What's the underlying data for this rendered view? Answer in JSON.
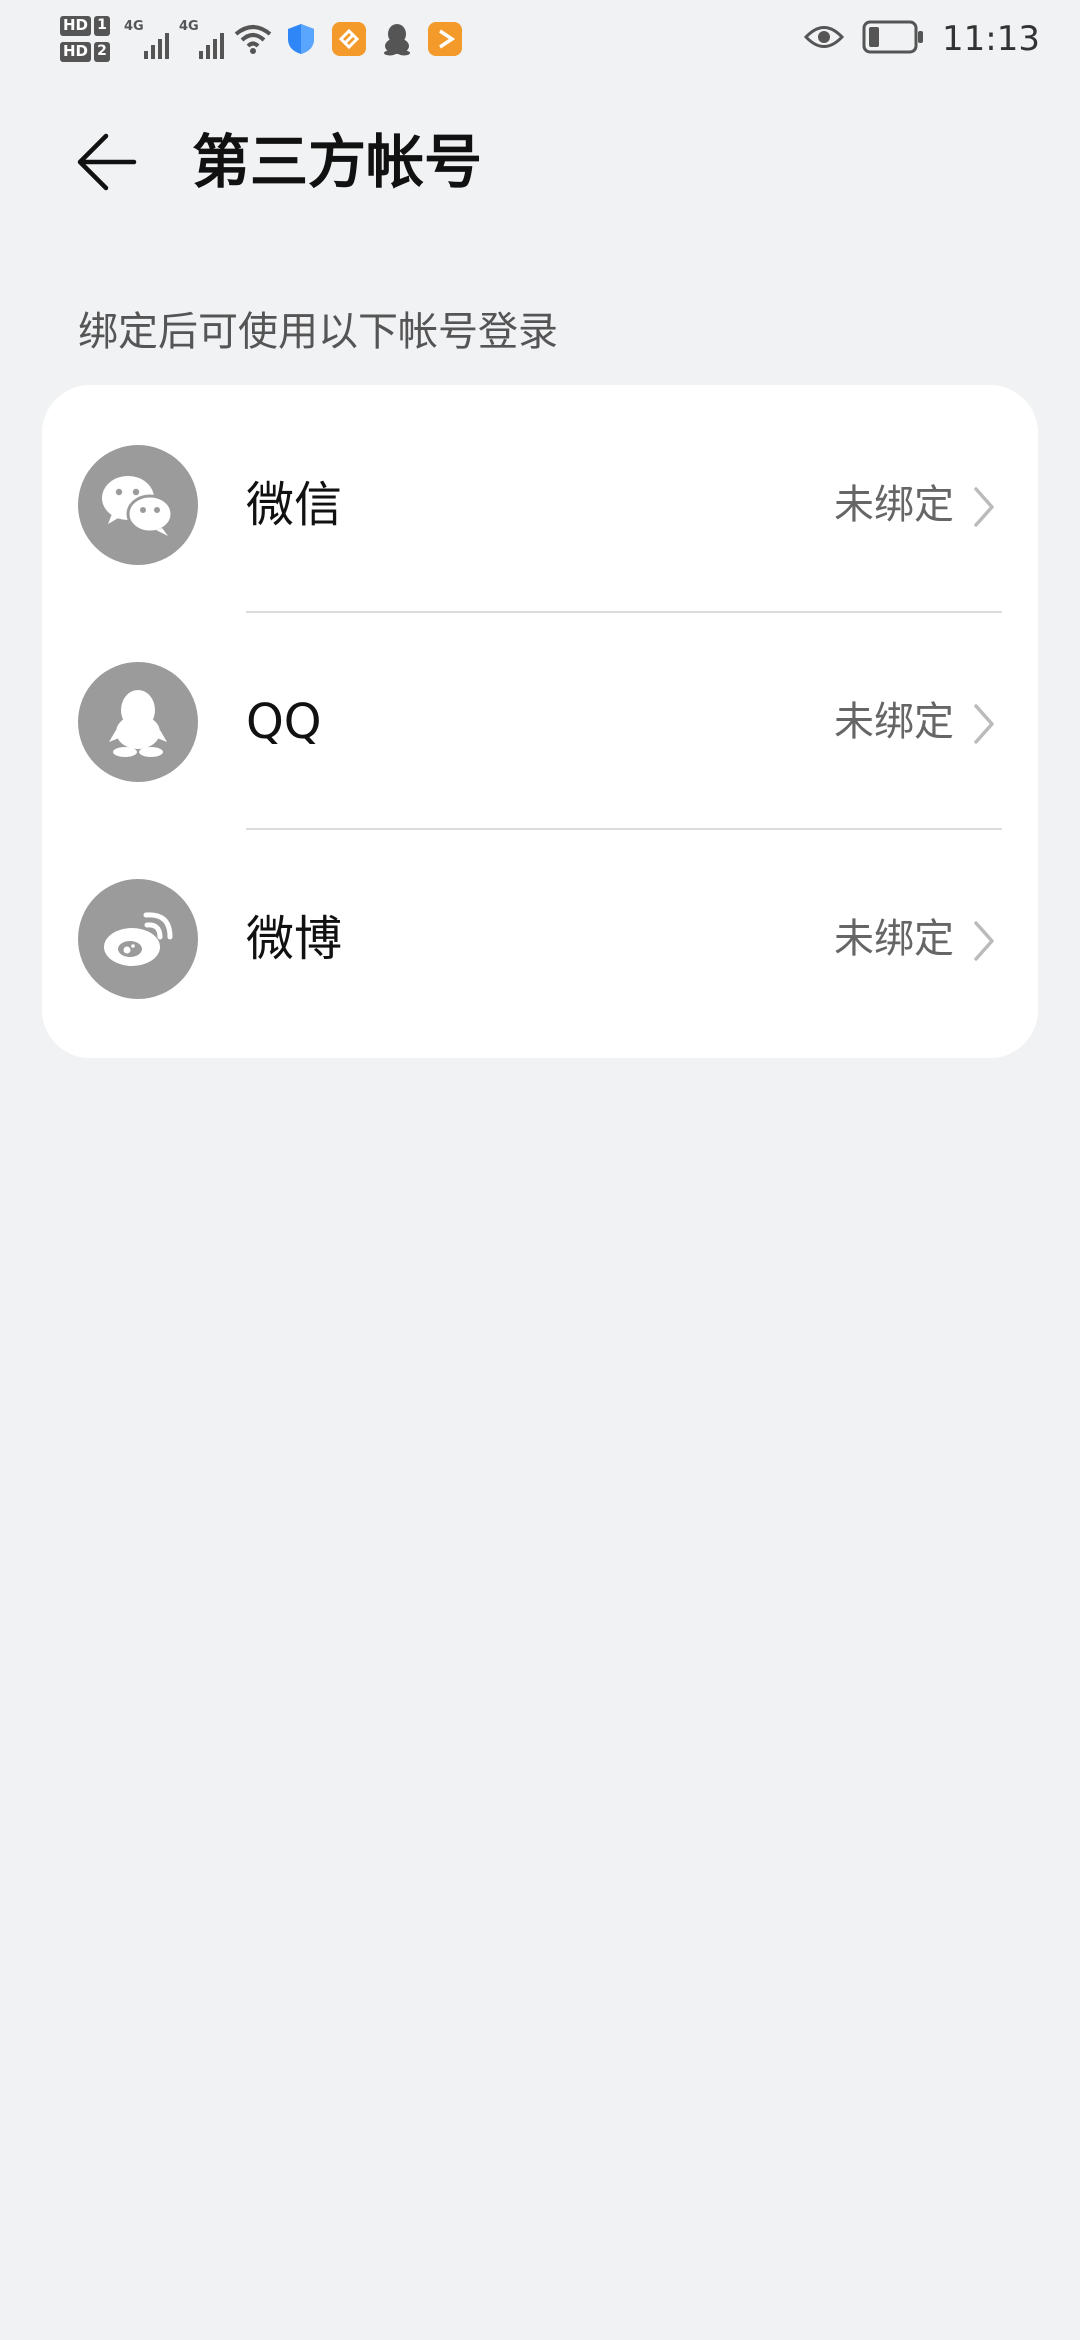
{
  "status_bar": {
    "hd_badge": "HD",
    "sim1": "1",
    "sim2": "2",
    "net1": "4G",
    "net2": "4G",
    "time": "11:13",
    "icons": [
      "signal-icon",
      "signal-icon",
      "wifi-icon",
      "shield-icon",
      "app-notification-icon",
      "qq-notification-icon",
      "app-notification-icon",
      "eye-icon",
      "battery-icon"
    ]
  },
  "header": {
    "title": "第三方帐号"
  },
  "section": {
    "caption": "绑定后可使用以下帐号登录"
  },
  "accounts": [
    {
      "name": "微信",
      "status": "未绑定",
      "icon": "wechat-icon"
    },
    {
      "name": "QQ",
      "status": "未绑定",
      "icon": "qq-icon"
    },
    {
      "name": "微博",
      "status": "未绑定",
      "icon": "weibo-icon"
    }
  ],
  "colors": {
    "background": "#f1f2f4",
    "card": "#ffffff",
    "icon_circle": "#9b9b9b",
    "shield": "#2f86f6",
    "app_orange": "#f39a2b"
  }
}
